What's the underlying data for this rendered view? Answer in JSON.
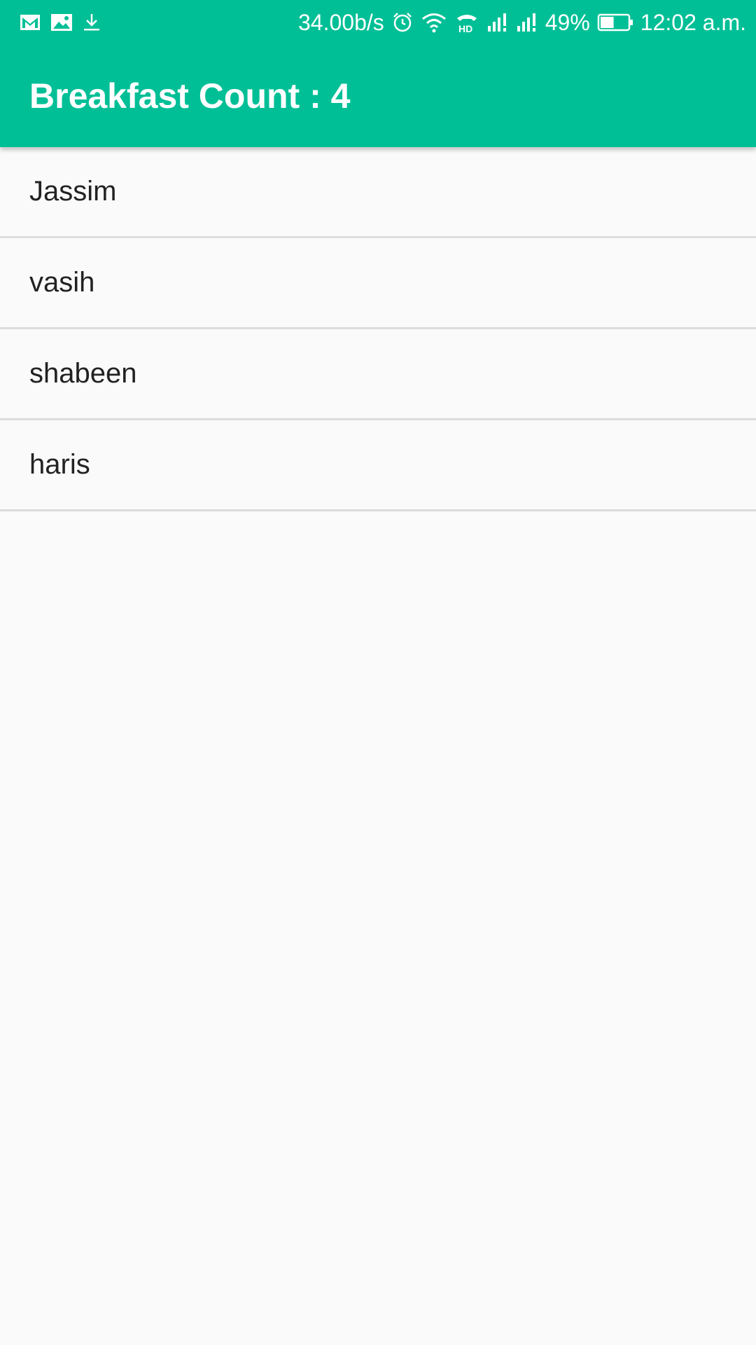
{
  "status_bar": {
    "left_icons": [
      "gmail-icon",
      "gallery-icon",
      "download-icon"
    ],
    "net_speed": "34.00b/s",
    "battery_percent": "49%",
    "time": "12:02 a.m.",
    "right_icons": [
      "alarm-icon",
      "wifi-icon",
      "hd-call-icon",
      "signal-icon",
      "signal-icon",
      "battery-icon"
    ],
    "battery_level": 0.49
  },
  "app_bar": {
    "title": "Breakfast Count : 4"
  },
  "list": {
    "items": [
      {
        "label": "Jassim"
      },
      {
        "label": "vasih"
      },
      {
        "label": "shabeen"
      },
      {
        "label": "haris"
      }
    ]
  },
  "colors": {
    "primary": "#00bf96",
    "background": "#fafafa",
    "divider": "#dcdcdc",
    "text": "#222222"
  }
}
